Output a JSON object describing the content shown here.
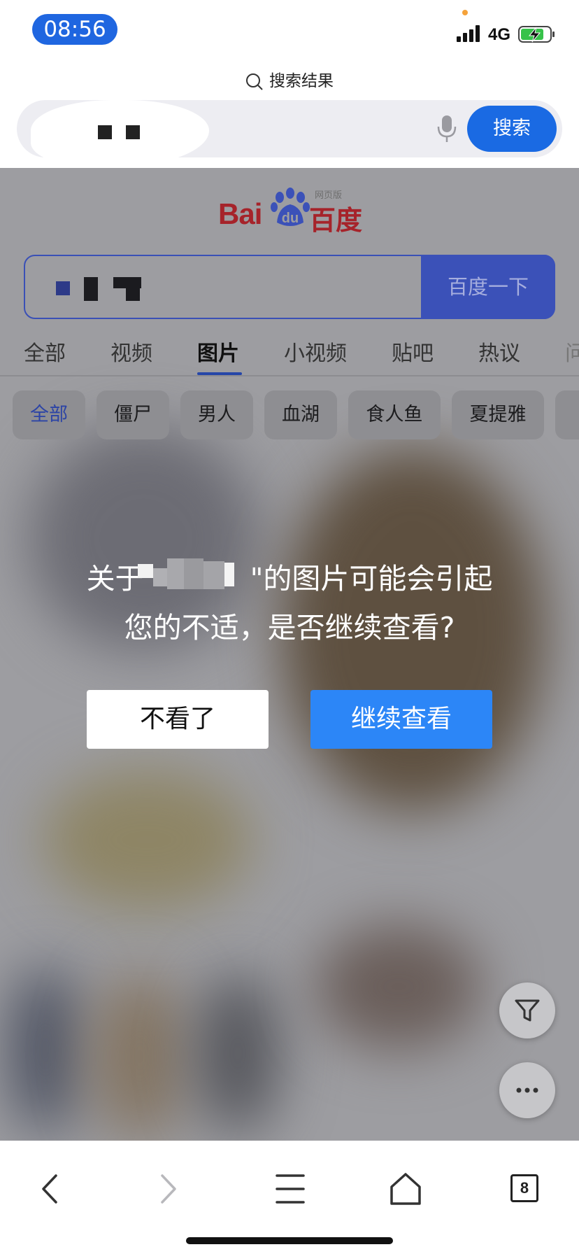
{
  "status_bar": {
    "time": "08:56",
    "network": "4G",
    "colors": {
      "time_pill": "#1f66e0",
      "battery_fill": "#37c24a",
      "dot": "#f5a23a"
    }
  },
  "top": {
    "caption": "搜索结果",
    "search_button": "搜索",
    "icons": [
      "search-icon",
      "microphone-icon"
    ]
  },
  "webpage": {
    "logo": {
      "latin": "Bai",
      "paw_text": "du",
      "chinese": "百度",
      "version": "网页版"
    },
    "search_button": "百度一下",
    "tabs": [
      {
        "label": "全部",
        "active": false
      },
      {
        "label": "视频",
        "active": false
      },
      {
        "label": "图片",
        "active": true
      },
      {
        "label": "小视频",
        "active": false
      },
      {
        "label": "贴吧",
        "active": false
      },
      {
        "label": "热议",
        "active": false
      },
      {
        "label": "问",
        "active": false
      }
    ],
    "chips": [
      {
        "label": "全部",
        "active": true
      },
      {
        "label": "僵尸",
        "active": false
      },
      {
        "label": "男人",
        "active": false
      },
      {
        "label": "血湖",
        "active": false
      },
      {
        "label": "食人鱼",
        "active": false
      },
      {
        "label": "夏提雅",
        "active": false
      }
    ],
    "colors": {
      "brand_red": "#a6232a",
      "brand_blue": "#3b51b8",
      "accent": "#2646a8"
    }
  },
  "dialog": {
    "line1_prefix": "关于",
    "line1_suffix": "\"的图片可能会引起",
    "line2": "您的不适，是否继续查看?",
    "decline_button": "不看了",
    "continue_button": "继续查看",
    "colors": {
      "continue": "#2c86f7"
    }
  },
  "floating_buttons": [
    "filter-icon",
    "more-icon"
  ],
  "toolbar": {
    "tab_count": "8",
    "icons": [
      "back-icon",
      "forward-icon",
      "menu-icon",
      "home-icon",
      "tabs-icon"
    ]
  }
}
